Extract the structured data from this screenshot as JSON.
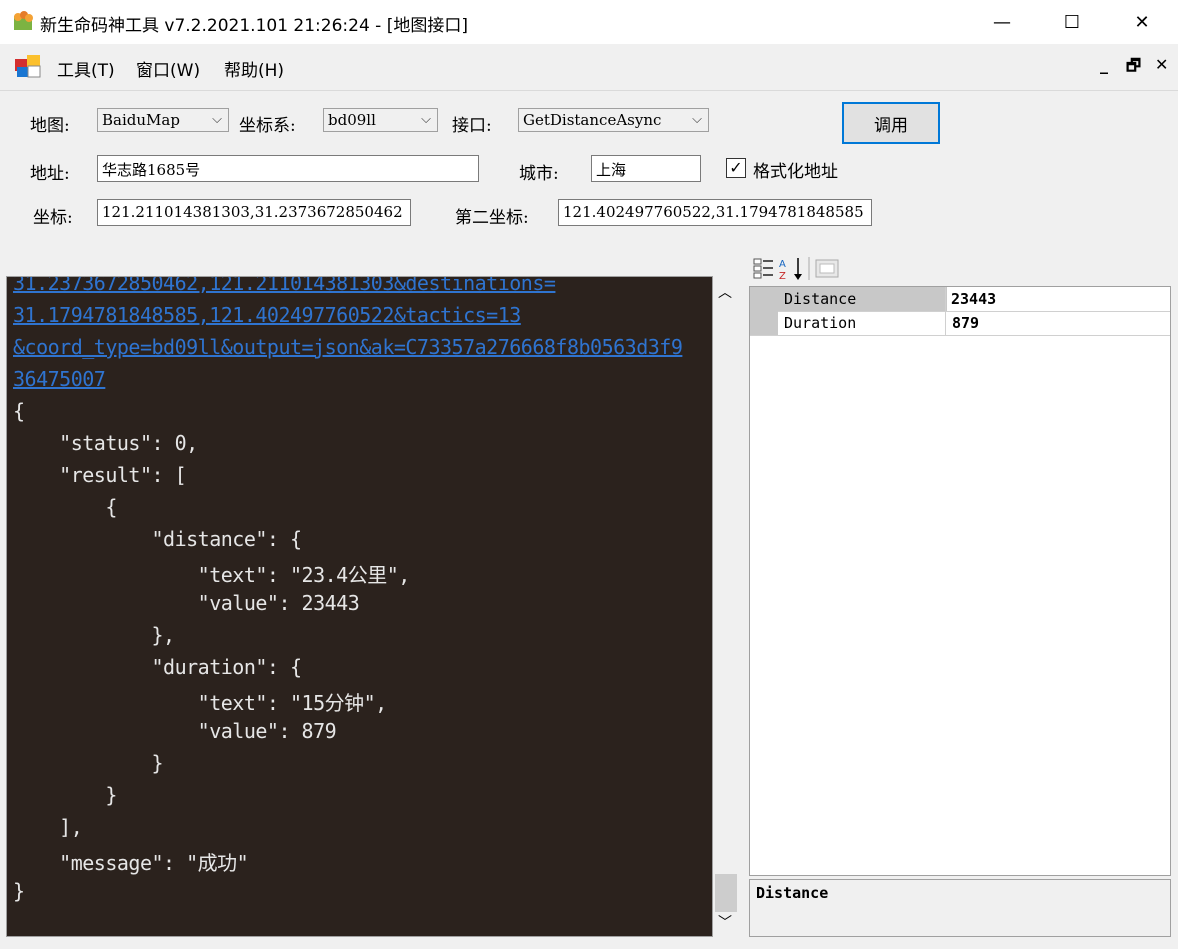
{
  "window": {
    "title": "新生命码神工具 v7.2.2021.101 21:26:24 - [地图接口]",
    "controls": [
      "—",
      "☐",
      "✕"
    ]
  },
  "menu": {
    "items": [
      "工具(T)",
      "窗口(W)",
      "帮助(H)"
    ],
    "mdi_controls": [
      "_",
      "🗗",
      "✕"
    ]
  },
  "form": {
    "map_label": "地图:",
    "map_value": "BaiduMap",
    "coord_sys_label": "坐标系:",
    "coord_sys_value": "bd09ll",
    "api_label": "接口:",
    "api_value": "GetDistanceAsync",
    "invoke_button": "调用",
    "address_label": "地址:",
    "address_value": "华志路1685号",
    "city_label": "城市:",
    "city_value": "上海",
    "format_checkbox_label": "格式化地址",
    "format_checked": "✓",
    "coord_label": "坐标:",
    "coord_value": "121.211014381303,31.2373672850462",
    "second_coord_label": "第二坐标:",
    "second_coord_value": "121.402497760522,31.1794781848585"
  },
  "editor": {
    "url_lines": [
      "31.2373672850462,121.211014381303&destinations=",
      "31.1794781848585,121.402497760522&tactics=13",
      "&coord_type=bd09ll&output=json&ak=C73357a276668f8b0563d3f9",
      "36475007"
    ],
    "json_lines": [
      "{",
      "    \"status\": 0,",
      "    \"result\": [",
      "        {",
      "            \"distance\": {",
      "                \"text\": \"23.4公里\",",
      "                \"value\": 23443",
      "            },",
      "            \"duration\": {",
      "                \"text\": \"15分钟\",",
      "                \"value\": 879",
      "            }",
      "        }",
      "    ],",
      "    \"message\": \"成功\"",
      "}"
    ]
  },
  "property_grid": {
    "rows": [
      {
        "name": "Distance",
        "value": "23443"
      },
      {
        "name": "Duration",
        "value": "879"
      }
    ],
    "description": "Distance"
  }
}
